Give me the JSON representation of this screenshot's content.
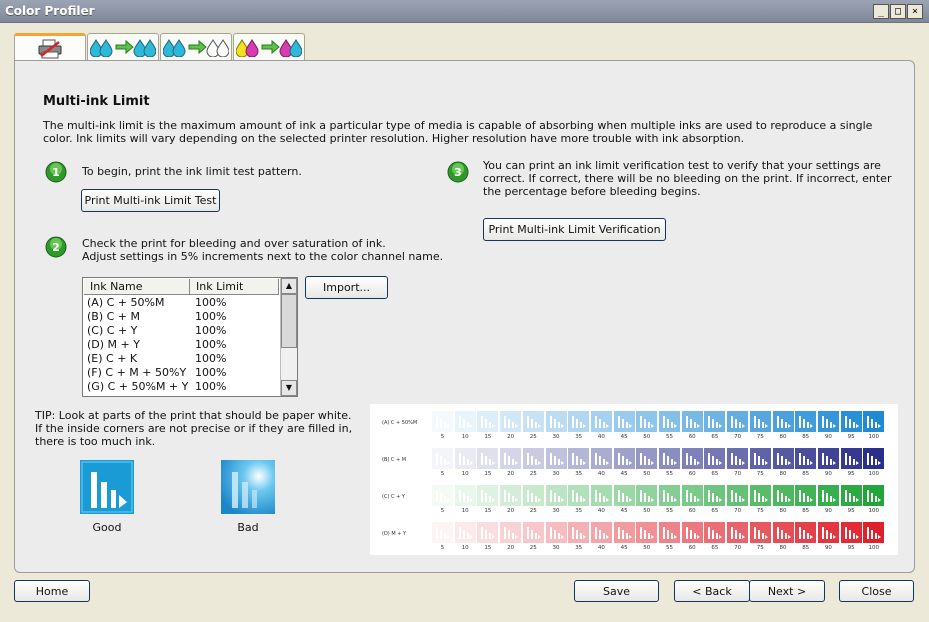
{
  "window": {
    "title": "Color Profiler"
  },
  "tabs": [
    {
      "name": "printer-setup-tab",
      "icon": "printer-icon",
      "active": true
    },
    {
      "name": "linearization-tab",
      "icon": "ink-drops-arrow-icon",
      "active": false
    },
    {
      "name": "ink-limit-tab",
      "icon": "ink-drops-arrow-outline-icon",
      "active": false
    },
    {
      "name": "profile-tab",
      "icon": "color-drops-arrow-icon",
      "active": false
    }
  ],
  "page": {
    "heading": "Multi-ink Limit",
    "description": "The multi-ink limit is the maximum amount of ink a particular type of media is capable of absorbing when multiple inks are used to reproduce a single color. Ink limits will vary depending on the selected printer resolution. Higher resolution have more trouble with ink absorption."
  },
  "steps": {
    "step1": {
      "text": "To begin, print the ink limit test pattern.",
      "button": "Print Multi-ink Limit Test"
    },
    "step2": {
      "line1": "Check the print for bleeding and over saturation of ink.",
      "line2": "Adjust settings in 5% increments next to the color channel name.",
      "import_button": "Import..."
    },
    "step3": {
      "text": "You can print an ink limit verification test to verify that your settings are correct. If correct, there will be no bleeding on the print. If incorrect, enter the percentage before bleeding begins.",
      "button": "Print Multi-ink Limit Verification"
    }
  },
  "ink_table": {
    "columns": [
      "Ink Name",
      "Ink Limit"
    ],
    "rows": [
      {
        "name": "(A) C + 50%M",
        "limit": "100%"
      },
      {
        "name": "(B) C + M",
        "limit": "100%"
      },
      {
        "name": "(C) C + Y",
        "limit": "100%"
      },
      {
        "name": "(D) M + Y",
        "limit": "100%"
      },
      {
        "name": "(E) C + K",
        "limit": "100%"
      },
      {
        "name": "(F) C + M + 50%Y",
        "limit": "100%"
      },
      {
        "name": "(G) C + 50%M + Y",
        "limit": "100%"
      }
    ]
  },
  "tip": {
    "text": "TIP: Look at parts of the print that should be paper white. If the inside corners are not precise or if they are filled in, there is too much ink.",
    "good_label": "Good",
    "bad_label": "Bad"
  },
  "test_pattern": {
    "percentages": [
      "5",
      "10",
      "15",
      "20",
      "25",
      "30",
      "35",
      "40",
      "45",
      "50",
      "55",
      "60",
      "65",
      "70",
      "75",
      "80",
      "85",
      "90",
      "95",
      "100"
    ],
    "rows": [
      {
        "label": "(A) C + 50%M",
        "color": "#1e8ad6"
      },
      {
        "label": "(B) C + M",
        "color": "#2a2f8c"
      },
      {
        "label": "(C) C + Y",
        "color": "#22a63a"
      },
      {
        "label": "(D) M + Y",
        "color": "#e0202a"
      }
    ]
  },
  "footer": {
    "home": "Home",
    "save": "Save",
    "back": "< Back",
    "next": "Next >",
    "close": "Close"
  }
}
